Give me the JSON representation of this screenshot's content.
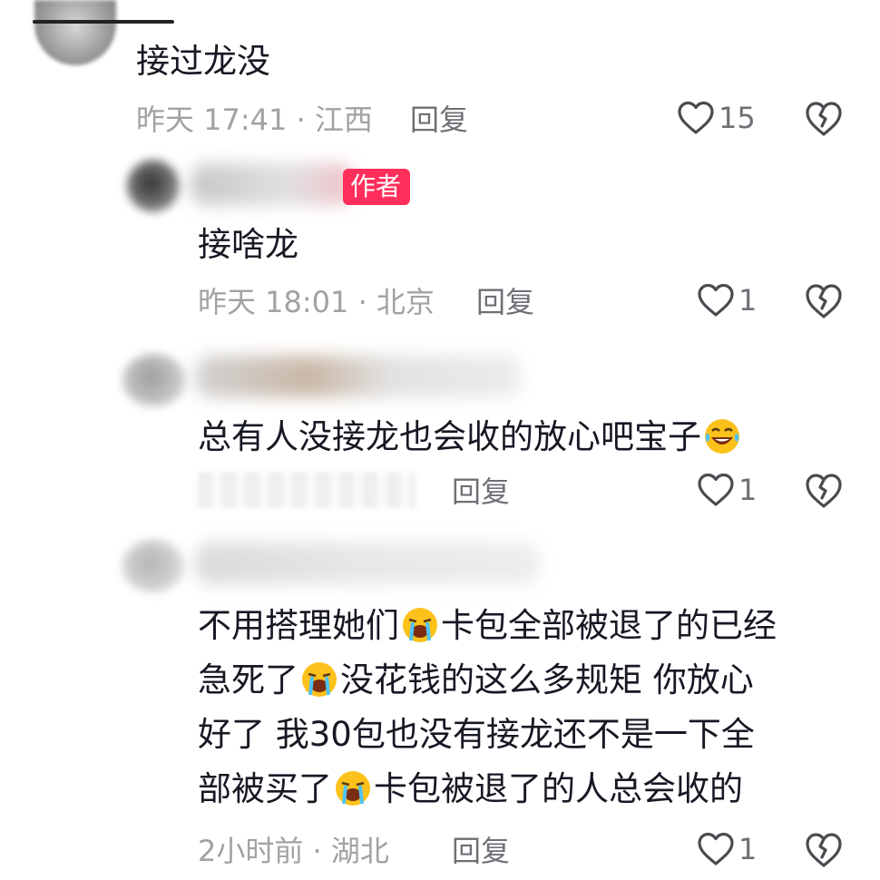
{
  "comments": [
    {
      "text": "接过龙没",
      "time_location": "昨天 17:41 · 江西",
      "reply_label": "回复",
      "like_count": "15"
    },
    {
      "badge": "作者",
      "text": "接啥龙",
      "time_location": "昨天 18:01 · 北京",
      "reply_label": "回复",
      "like_count": "1"
    },
    {
      "text_before_emoji": "总有人没接龙也会收的放心吧宝子",
      "reply_label": "回复",
      "like_count": "1"
    },
    {
      "line1_a": "不用搭理她们",
      "line1_b": "卡包全部被退了的已经",
      "line2_a": "急死了",
      "line2_b": "没花钱的这么多规矩 你放心",
      "line3": "好了 我30包也没有接龙还不是一下全",
      "line4_a": "部被买了",
      "line4_b": "卡包被退了的人总会收的",
      "time_location": "2小时前 · 湖北",
      "reply_label": "回复",
      "like_count": "1"
    }
  ],
  "icons": {
    "like": "heart-outline-icon",
    "dislike": "broken-heart-icon",
    "emoji_laugh": "tears-of-joy-emoji",
    "emoji_cry": "loudly-crying-emoji"
  },
  "colors": {
    "badge_bg": "#ff2e5b",
    "meta_gray": "#a1a2a6",
    "text_dark": "#161823"
  }
}
